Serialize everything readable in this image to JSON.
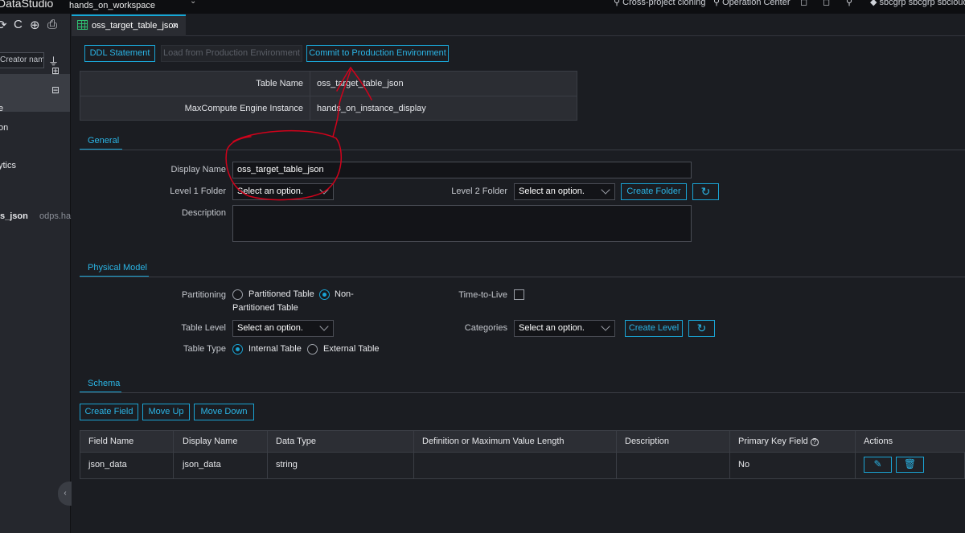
{
  "topbar": {
    "brand": "DataStudio",
    "workspace": "hands_on_workspace",
    "cross_project": "Cross-project cloning",
    "operation_center": "Operation Center",
    "user": "sbcgrp sbcgrp sbcloud"
  },
  "sidebar": {
    "search_placeholder": "Creator name",
    "items": [
      "e",
      "on",
      "",
      "ytics"
    ],
    "last_item": "s_json",
    "last_item_sub": "odps.ha"
  },
  "tab": {
    "label": "oss_target_table_json"
  },
  "toolbar": {
    "ddl": "DDL Statement",
    "load": "Load from Production Environment",
    "commit": "Commit to Production Environment"
  },
  "info": {
    "table_name_label": "Table Name",
    "table_name_value": "oss_target_table_json",
    "engine_label": "MaxCompute Engine Instance",
    "engine_value": "hands_on_instance_display"
  },
  "general": {
    "section": "General",
    "display_name_label": "Display Name",
    "display_name_value": "oss_target_table_json",
    "level1_label": "Level 1 Folder",
    "level1_value": "Select an option.",
    "level2_label": "Level 2 Folder",
    "level2_value": "Select an option.",
    "create_folder": "Create Folder",
    "description_label": "Description"
  },
  "physical": {
    "section": "Physical Model",
    "partitioning_label": "Partitioning",
    "partitioned": "Partitioned Table",
    "non_partitioned_1": "Non-",
    "non_partitioned_2": "Partitioned Table",
    "partitioning_selected": "Non-Partitioned Table",
    "ttl_label": "Time-to-Live",
    "table_level_label": "Table Level",
    "table_level_value": "Select an option.",
    "categories_label": "Categories",
    "categories_value": "Select an option.",
    "create_level": "Create Level",
    "table_type_label": "Table Type",
    "internal": "Internal Table",
    "external": "External Table",
    "table_type_selected": "Internal Table"
  },
  "schema": {
    "section": "Schema",
    "create_field": "Create Field",
    "move_up": "Move Up",
    "move_down": "Move Down",
    "columns": [
      "Field Name",
      "Display Name",
      "Data Type",
      "Definition or Maximum Value Length",
      "Description",
      "Primary Key Field",
      "Actions"
    ],
    "rows": [
      {
        "field_name": "json_data",
        "display_name": "json_data",
        "data_type": "string",
        "definition": "",
        "description": "",
        "primary_key": "No"
      }
    ]
  },
  "annotation": {
    "color": "#d0021b"
  },
  "colors": {
    "accent": "#1aa3d3",
    "background": "#1b1d22",
    "panel": "#2b2d33"
  }
}
